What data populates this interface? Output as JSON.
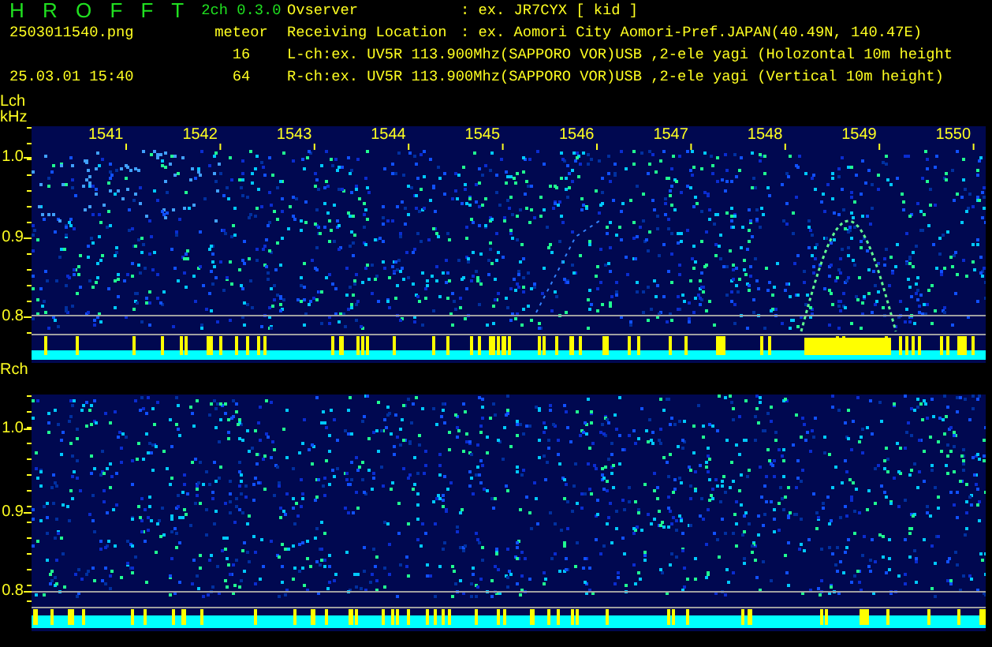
{
  "header": {
    "app_name": "H R O F F T",
    "version": "2ch 0.3.0",
    "filename": "2503011540.png",
    "mode": "meteor",
    "timestamp": "25.03.01 15:40",
    "counts": [
      "16",
      "64"
    ]
  },
  "info": [
    {
      "kind": "field",
      "label": "Ovserver",
      "value": ": ex. JR7CYX [ kid ]"
    },
    {
      "kind": "field",
      "label": "Receiving Location",
      "value": ": ex. Aomori City Aomori-Pref.JAPAN(40.49N, 140.47E)"
    },
    {
      "kind": "line",
      "text": "L-ch:ex. UV5R 113.900Mhz(SAPPORO VOR)USB ,2-ele yagi (Holozontal 10m height"
    },
    {
      "kind": "line",
      "text": "R-ch:ex. UV5R 113.900Mhz(SAPPORO VOR)USB ,2-ele yagi (Vertical 10m height)"
    }
  ],
  "panels": [
    {
      "channel": "Lch",
      "unit": "kHz",
      "time_labels": [
        "1541",
        "1542",
        "1543",
        "1544",
        "1545",
        "1546",
        "1547",
        "1548",
        "1549",
        "1550"
      ],
      "freq_labels": [
        "1.0",
        "0.9",
        "0.8"
      ]
    },
    {
      "channel": "Rch",
      "freq_labels": [
        "1.0",
        "0.9",
        "0.8"
      ]
    }
  ]
}
